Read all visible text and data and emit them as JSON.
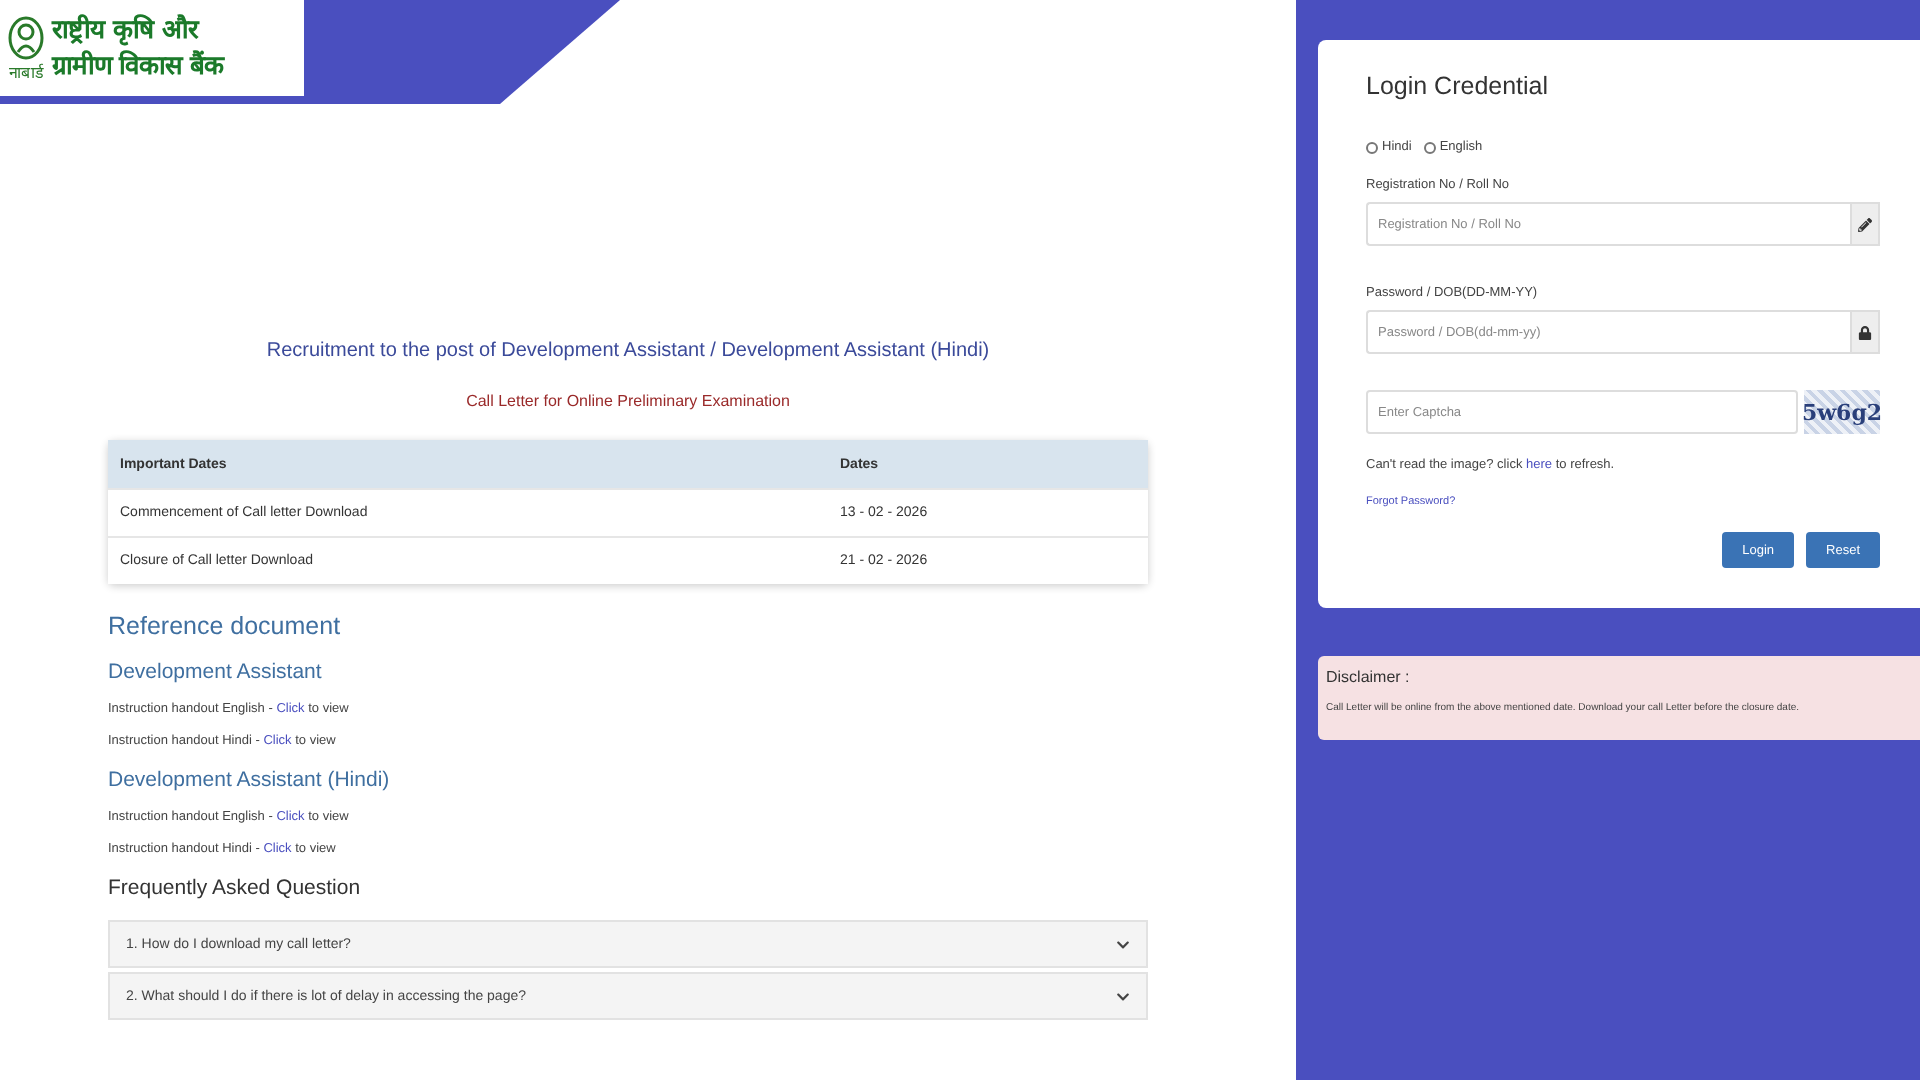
{
  "logo": {
    "caption": "नाबार्ड",
    "lines": [
      "राष्ट्रीय कृषि और",
      "ग्रामीण विकास बैंक"
    ]
  },
  "heading": "Recruitment to the post of Development Assistant / Development Assistant (Hindi)",
  "subheading": "Call Letter for Online Preliminary Examination",
  "dates_table": {
    "columns": [
      "Important Dates",
      "Dates"
    ],
    "rows": [
      [
        "Commencement of Call letter Download",
        "13 - 02 - 2026"
      ],
      [
        "Closure of Call letter Download",
        "21 - 02 - 2026"
      ]
    ]
  },
  "reference": {
    "title": "Reference document",
    "sections": [
      {
        "title": "Development Assistant",
        "items": [
          {
            "prefix": "Instruction handout English - ",
            "link": "Click",
            "suffix": "to view"
          },
          {
            "prefix": "Instruction handout Hindi - ",
            "link": "Click",
            "suffix": "to view"
          }
        ]
      },
      {
        "title": "Development Assistant (Hindi)",
        "items": [
          {
            "prefix": "Instruction handout English - ",
            "link": "Click",
            "suffix": "to view"
          },
          {
            "prefix": "Instruction handout Hindi - ",
            "link": "Click",
            "suffix": "to view"
          }
        ]
      }
    ]
  },
  "faq": {
    "title": "Frequently Asked Question",
    "items": [
      {
        "question": "1. How do I download my call letter?",
        "expanded": false
      },
      {
        "question": "2. What should I do if there is lot of delay in accessing the page?",
        "expanded": false
      }
    ]
  },
  "login": {
    "title": "Login Credential",
    "languages": [
      {
        "label": "Hindi",
        "selected": false
      },
      {
        "label": "English",
        "selected": false
      }
    ],
    "fields": [
      {
        "label": "Registration No / Roll No",
        "placeholder": "Registration No / Roll No",
        "kind": "text"
      },
      {
        "label": "Password / DOB(DD-MM-YY)",
        "placeholder": "Password / DOB(dd-mm-yy)",
        "kind": "password"
      }
    ],
    "captcha": {
      "placeholder": "Enter Captcha",
      "image_text": "5w6g2"
    },
    "refresh": {
      "prefix": "Can't read the image? click ",
      "link": "here",
      "suffix": " to refresh."
    },
    "forgot": "Forgot Password?",
    "buttons": [
      "Login",
      "Reset"
    ]
  },
  "disclaimer": {
    "title": "Disclaimer :",
    "text": "Call Letter will be online from the above mentioned date. Download your call Letter before the closure date."
  }
}
